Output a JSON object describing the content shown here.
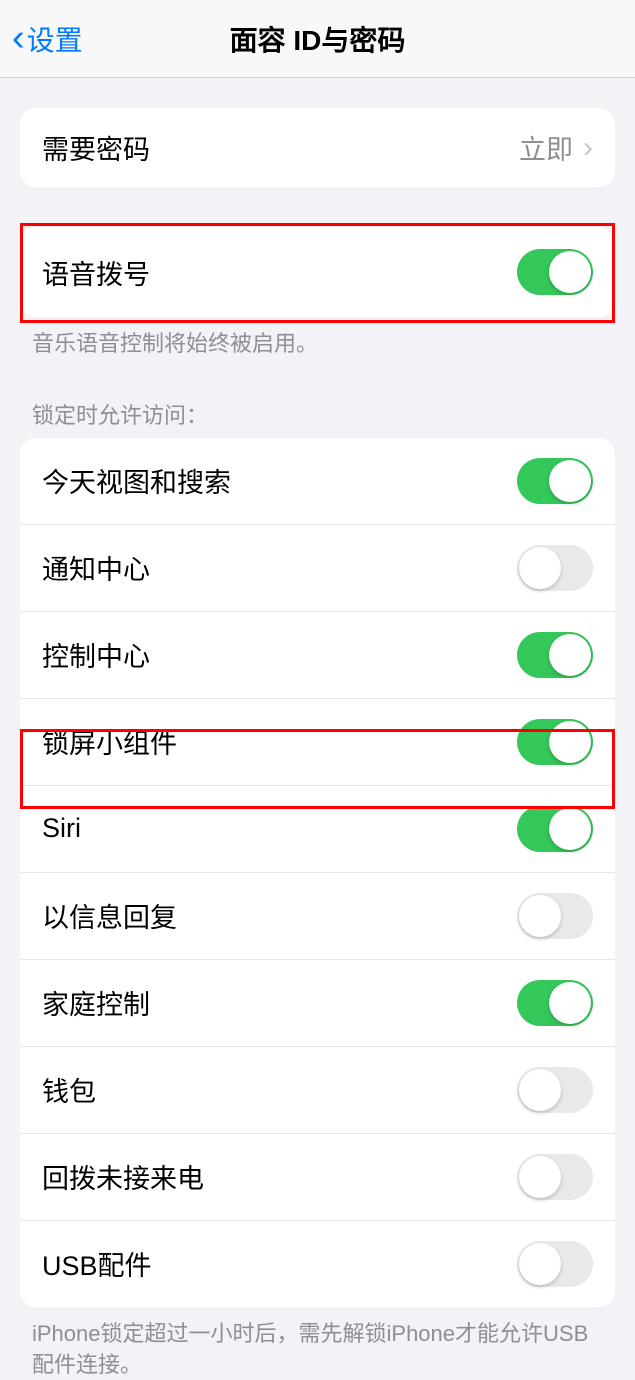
{
  "header": {
    "back_label": "设置",
    "title": "面容 ID与密码"
  },
  "passcode_group": {
    "require_passcode_label": "需要密码",
    "require_passcode_value": "立即"
  },
  "voice_dial": {
    "label": "语音拨号",
    "enabled": true,
    "footer": "音乐语音控制将始终被启用。"
  },
  "lock_access": {
    "header": "锁定时允许访问：",
    "items": [
      {
        "label": "今天视图和搜索",
        "enabled": true
      },
      {
        "label": "通知中心",
        "enabled": false
      },
      {
        "label": "控制中心",
        "enabled": true
      },
      {
        "label": "锁屏小组件",
        "enabled": true
      },
      {
        "label": "Siri",
        "enabled": true
      },
      {
        "label": "以信息回复",
        "enabled": false
      },
      {
        "label": "家庭控制",
        "enabled": true
      },
      {
        "label": "钱包",
        "enabled": false
      },
      {
        "label": "回拨未接来电",
        "enabled": false
      },
      {
        "label": "USB配件",
        "enabled": false
      }
    ],
    "footer": "iPhone锁定超过一小时后，需先解锁iPhone才能允许USB配件连接。"
  }
}
